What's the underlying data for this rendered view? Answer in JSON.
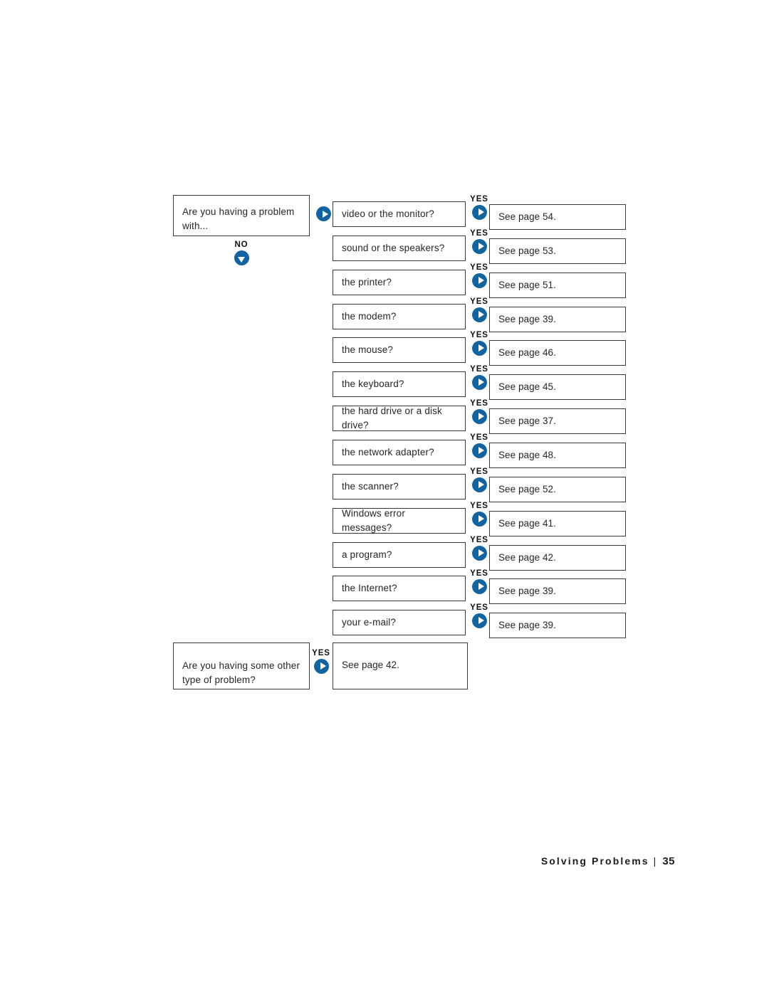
{
  "document": {
    "footer": {
      "section_title": "Solving Problems",
      "separator": "|",
      "page_number": "35"
    }
  },
  "flowchart": {
    "start_node": {
      "label": "Are you having a problem with...",
      "no_branch": {
        "label": "NO",
        "icon": "arrow-down-circle-icon"
      },
      "yes_icon": "arrow-right-circle-icon"
    },
    "branch_label": "YES",
    "branch_icon": "arrow-right-circle-icon",
    "rows": [
      {
        "question": "video or the monitor?",
        "answer": "See page 54."
      },
      {
        "question": "sound or the speakers?",
        "answer": "See page 53."
      },
      {
        "question": "the printer?",
        "answer": "See page 51."
      },
      {
        "question": "the modem?",
        "answer": "See page 39."
      },
      {
        "question": "the mouse?",
        "answer": "See page 46."
      },
      {
        "question": "the keyboard?",
        "answer": "See page 45."
      },
      {
        "question": "the hard drive or a disk drive?",
        "answer": "See page 37."
      },
      {
        "question": "the network adapter?",
        "answer": "See page 48."
      },
      {
        "question": "the scanner?",
        "answer": "See page 52."
      },
      {
        "question": "Windows error messages?",
        "answer": "See page 41."
      },
      {
        "question": "a program?",
        "answer": "See page 42."
      },
      {
        "question": "the Internet?",
        "answer": "See page 39."
      },
      {
        "question": "your e-mail?",
        "answer": "See page 39."
      }
    ],
    "other_node": {
      "question": "Are you having some other type of problem?",
      "label": "YES",
      "icon": "arrow-right-circle-icon",
      "answer": "See page 42."
    }
  },
  "colors": {
    "accent_blue": "#13639f",
    "box_border": "#3a3a3a",
    "text": "#262626"
  }
}
